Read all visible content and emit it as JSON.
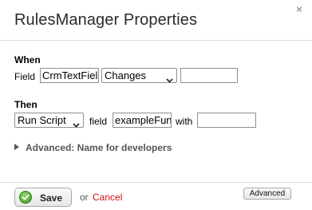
{
  "dialog": {
    "title": "RulesManager Properties",
    "close_glyph": "×",
    "close_icon": "close-icon"
  },
  "when": {
    "heading": "When",
    "field_label": "Field",
    "field_value": "CrmTextField",
    "condition_selected": "Changes",
    "condition_value": ""
  },
  "then": {
    "heading": "Then",
    "action_selected": "Run Script",
    "field_label": "field",
    "field_value": "exampleFunction",
    "with_label": "with",
    "with_value": ""
  },
  "advanced_section": {
    "label": "Advanced: Name for developers",
    "icon": "triangle-right-icon"
  },
  "footer": {
    "save_label": "Save",
    "save_icon": "checkmark-icon",
    "or_text": "or",
    "cancel_label": "Cancel",
    "advanced_button_label": "Advanced"
  },
  "colors": {
    "cancel": "#cc1111",
    "save_icon_green": "#3f9a1f"
  }
}
